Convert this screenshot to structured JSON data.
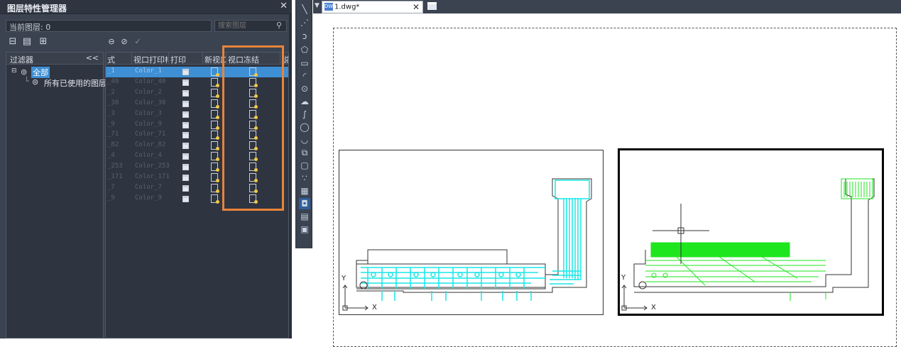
{
  "panel": {
    "title": "图层特性管理器",
    "close": "✕",
    "current_layer_label": "当前图层: 0",
    "search_placeholder": "搜索图层"
  },
  "filters": {
    "header": "过滤器",
    "collapse": "<<",
    "all": "全部",
    "used": "所有已使用的图层"
  },
  "table": {
    "columns": [
      "式",
      "视口打印样",
      "打印",
      "新视口",
      "视口冻结",
      "说"
    ],
    "rows": [
      {
        "name": "_1",
        "style": "Color_1",
        "selected": true
      },
      {
        "name": "_40",
        "style": "Color_40"
      },
      {
        "name": "_2",
        "style": "Color_2"
      },
      {
        "name": "_30",
        "style": "Color_30"
      },
      {
        "name": "_3",
        "style": "Color_3"
      },
      {
        "name": "_9",
        "style": "Color_9"
      },
      {
        "name": "_71",
        "style": "Color_71"
      },
      {
        "name": "_82",
        "style": "Color_82"
      },
      {
        "name": "_4",
        "style": "Color_4"
      },
      {
        "name": "_253",
        "style": "Color_253"
      },
      {
        "name": "_171",
        "style": "Color_171"
      },
      {
        "name": "_7",
        "style": "Color_7"
      },
      {
        "name": "_9",
        "style": "Color_9"
      }
    ]
  },
  "document": {
    "tab_label": "1.dwg*",
    "tab_close": "✕"
  },
  "ucs": {
    "x": "X",
    "y": "Y"
  },
  "colors": {
    "accent": "#3e8fd4",
    "highlight": "#e8843a",
    "pcb_cyan": "#18e6e6",
    "pcb_green": "#1ee61e"
  }
}
